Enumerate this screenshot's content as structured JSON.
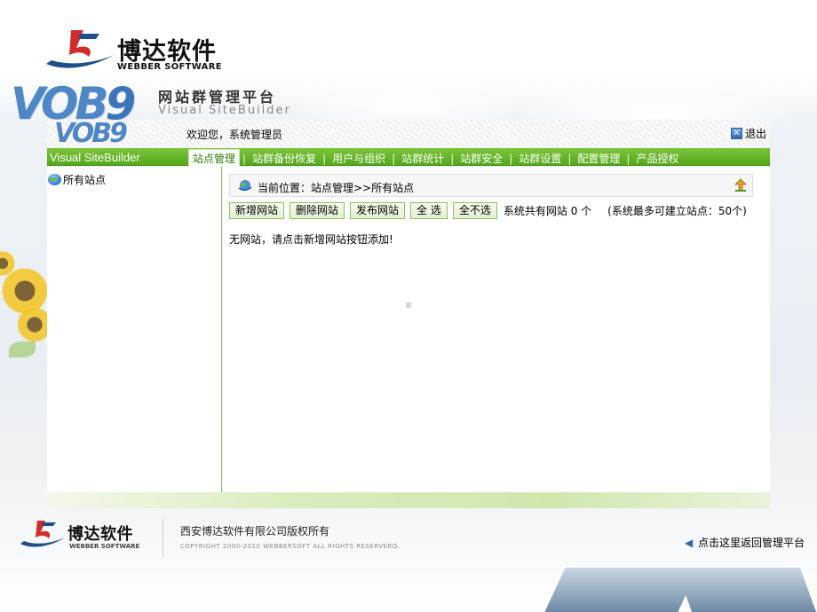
{
  "brand": {
    "name_cn": "博达软件",
    "name_en": "WEBBER SOFTWARE"
  },
  "product": {
    "logo_text": "VOB",
    "logo_digit": "9",
    "title": "网站群管理平台",
    "subtitle": "Visual SiteBuilder"
  },
  "header": {
    "welcome": "欢迎您，系统管理员",
    "logout_label": "退出",
    "logout_icon": "close-box-icon"
  },
  "navbar": {
    "sitebuilder_label": "Visual SiteBuilder",
    "items": [
      {
        "label": "站点管理",
        "active": true
      },
      {
        "label": "站群备份恢复",
        "active": false
      },
      {
        "label": "用户与组织",
        "active": false
      },
      {
        "label": "站群统计",
        "active": false
      },
      {
        "label": "站群安全",
        "active": false
      },
      {
        "label": "站群设置",
        "active": false
      },
      {
        "label": "配置管理",
        "active": false
      },
      {
        "label": "产品授权",
        "active": false
      }
    ]
  },
  "sidebar": {
    "tree_root_label": "所有站点",
    "tree_root_icon": "globe-icon"
  },
  "main": {
    "breadcrumb": "当前位置：站点管理>>所有站点",
    "buttons": {
      "add_site": "新增网站",
      "delete_site": "删除网站",
      "publish_site": "发布网站",
      "select_all": "全 选",
      "select_none": "全不选"
    },
    "site_count_text": "系统共有网站 0 个",
    "site_max_text": "(系统最多可建立站点：50个)",
    "empty_message": "无网站，请点击新增网站按钮添加!"
  },
  "footer": {
    "logo_cn": "博达软件",
    "logo_en": "WEBBER SOFTWARE",
    "company": "西安博达软件有限公司版权所有",
    "copyright": "COPYRIGHT 2000-2010 WEBBERSOFT ALL RIGHTS RESERVERD.",
    "back_link": "点击这里返回管理平台"
  },
  "colors": {
    "nav_green": "#5db024",
    "logo_blue": "#4f86c6",
    "button_border": "#8fbf60"
  }
}
